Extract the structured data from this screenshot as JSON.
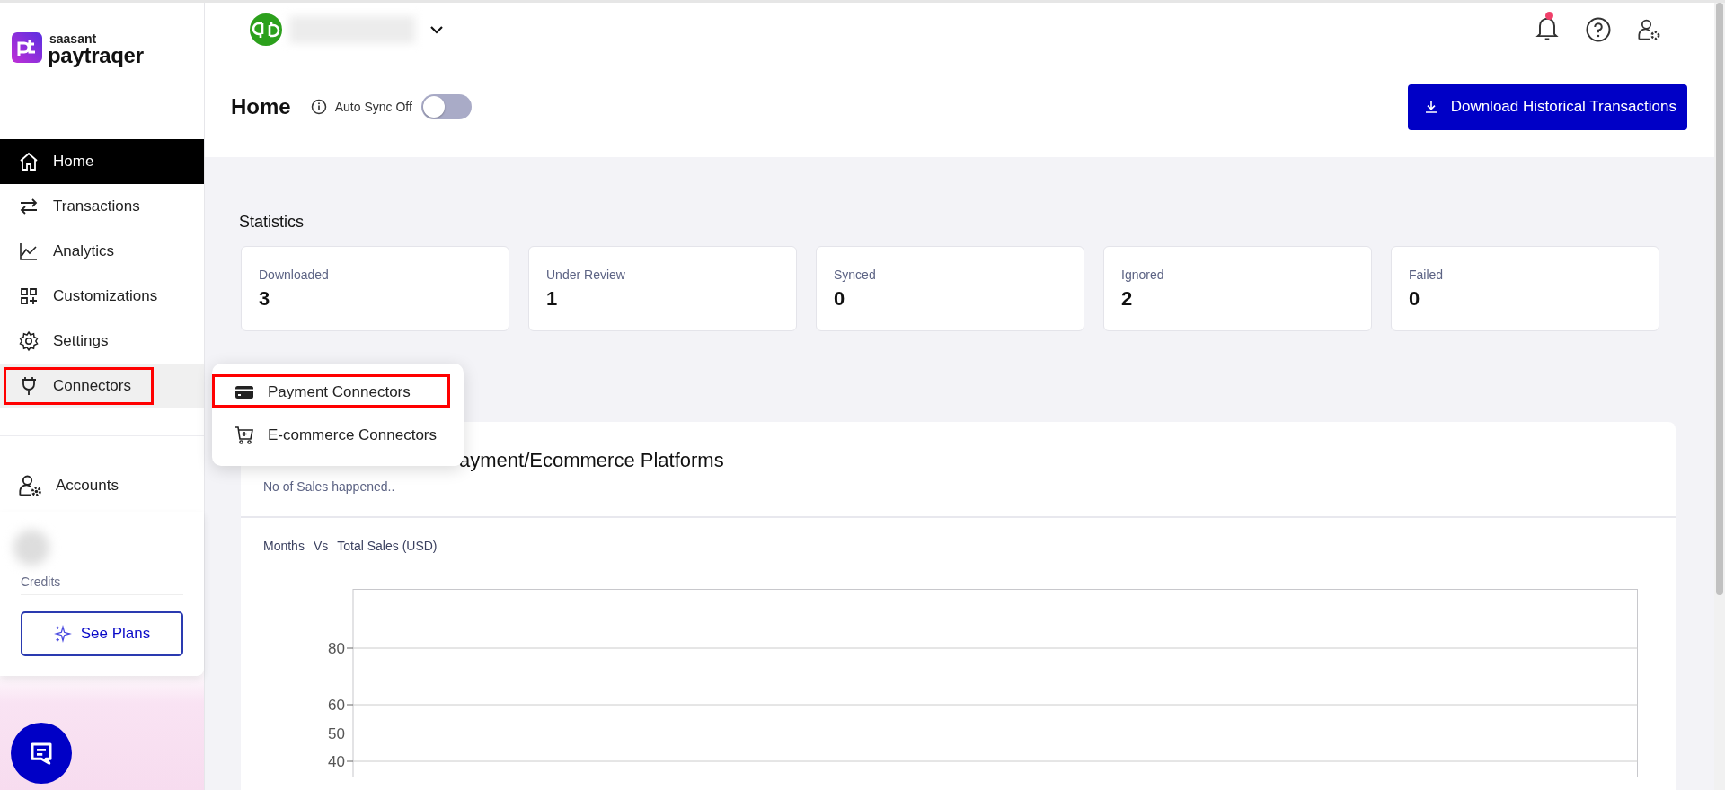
{
  "brand": {
    "company": "saasant",
    "product": "paytraqer"
  },
  "sidebar": {
    "items": [
      {
        "label": "Home",
        "selected": true,
        "hovered": false,
        "highlighted": false
      },
      {
        "label": "Transactions",
        "selected": false,
        "hovered": false,
        "highlighted": false
      },
      {
        "label": "Analytics",
        "selected": false,
        "hovered": false,
        "highlighted": false
      },
      {
        "label": "Customizations",
        "selected": false,
        "hovered": false,
        "highlighted": false
      },
      {
        "label": "Settings",
        "selected": false,
        "hovered": false,
        "highlighted": false
      },
      {
        "label": "Connectors",
        "selected": false,
        "hovered": true,
        "highlighted": true
      }
    ],
    "accounts": "Accounts",
    "credits": "Credits",
    "plans_button": "See Plans"
  },
  "connector_menu": {
    "items": [
      {
        "label": "Payment Connectors",
        "highlighted": true
      },
      {
        "label": "E-commerce Connectors",
        "highlighted": false
      }
    ]
  },
  "top_bar": {
    "notification_unread": true
  },
  "page_header": {
    "title": "Home",
    "auto_sync_label": "Auto Sync Off",
    "auto_sync_on": false,
    "download_button": "Download Historical Transactions"
  },
  "statistics": {
    "title": "Statistics",
    "cards": [
      {
        "label": "Downloaded",
        "value": "3"
      },
      {
        "label": "Under Review",
        "value": "1"
      },
      {
        "label": "Synced",
        "value": "0"
      },
      {
        "label": "Ignored",
        "value": "2"
      },
      {
        "label": "Failed",
        "value": "0"
      }
    ]
  },
  "sales_chart": {
    "title": "ayment/Ecommerce Platforms",
    "subtitle": "No of Sales happened..",
    "axis_x_label": "Months",
    "versus": "Vs",
    "axis_y_label": "Total Sales (USD)",
    "y_tick_labels": [
      "80",
      "60",
      "50",
      "40"
    ]
  }
}
